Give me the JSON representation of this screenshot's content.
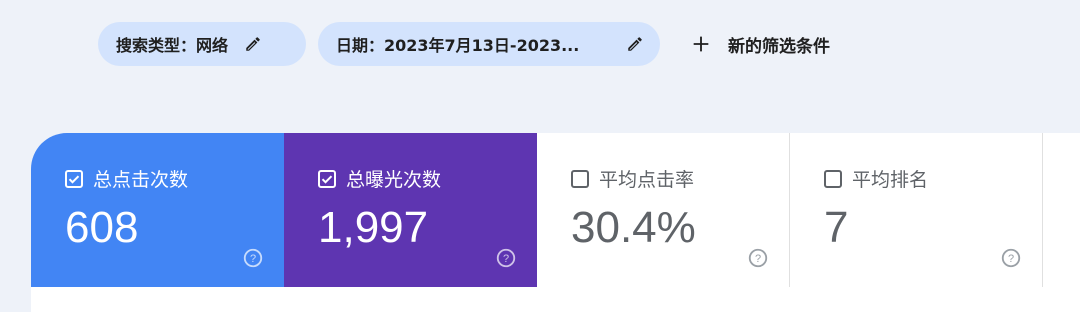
{
  "filters": {
    "search_type": "搜索类型：网络",
    "date": "日期：2023年7月13日-2023...",
    "add_filter": "新的筛选条件"
  },
  "metrics": [
    {
      "label": "总点击次数",
      "value": "608",
      "checked": true,
      "color": "#4285f4"
    },
    {
      "label": "总曝光次数",
      "value": "1,997",
      "checked": true,
      "color": "#5e35b1"
    },
    {
      "label": "平均点击率",
      "value": "30.4%",
      "checked": false,
      "color": "#ffffff"
    },
    {
      "label": "平均排名",
      "value": "7",
      "checked": false,
      "color": "#ffffff"
    }
  ],
  "icons": {
    "edit": "pencil-icon",
    "add": "plus-icon",
    "checkbox_checked": "checkbox-checked-icon",
    "checkbox_unchecked": "checkbox-unchecked-icon",
    "help": "help-circle-icon"
  }
}
